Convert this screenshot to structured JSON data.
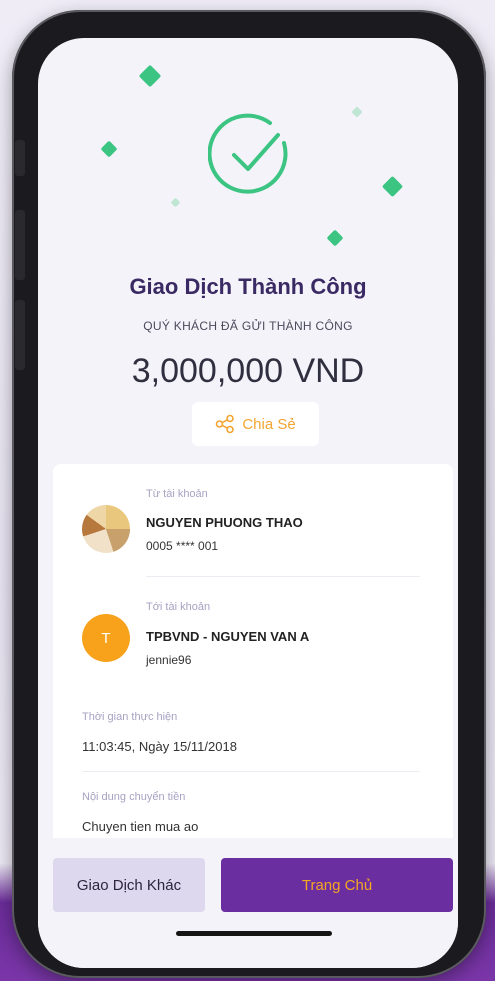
{
  "result": {
    "title": "Giao Dịch Thành Công",
    "subtitle": "QUÝ KHÁCH ĐÃ GỬI THÀNH CÔNG",
    "amount": "3,000,000 VND",
    "share_label": "Chia Sẻ"
  },
  "from": {
    "label": "Từ tài khoản",
    "name": "NGUYEN PHUONG THAO",
    "account": "0005 **** 001"
  },
  "to": {
    "label": "Tới tài khoản",
    "avatar_letter": "T",
    "name": "TPBVND - NGUYEN VAN A",
    "account": "jennie96"
  },
  "time": {
    "label": "Thời gian thực hiện",
    "value": "11:03:45, Ngày 15/11/2018"
  },
  "content": {
    "label": "Nội dung chuyển tiền",
    "value": "Chuyen tien mua ao"
  },
  "actions": {
    "other_label": "Giao Dịch Khác",
    "home_label": "Trang Chủ"
  },
  "colors": {
    "success_green": "#3cc482",
    "accent_purple": "#6a2ea0",
    "accent_orange": "#f5a623"
  }
}
